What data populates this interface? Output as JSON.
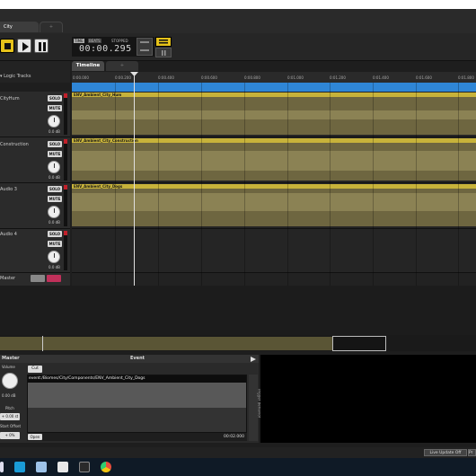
{
  "tabs": {
    "active": "City",
    "new_tab": "+"
  },
  "transport": {
    "chips": [
      "TIME",
      "BEATS",
      "STOPPED"
    ],
    "time": "00:00.295"
  },
  "tracks_header": {
    "label": "Logic Tracks"
  },
  "timeline": {
    "tab_label": "Timeline",
    "tab2_label": "+",
    "ticks": [
      "0:00.000",
      "0:00.200",
      "0:00.400",
      "0:00.600",
      "0:00.800",
      "0:01.000",
      "0:01.200",
      "0:01.400",
      "0:01.600",
      "0:01.800"
    ]
  },
  "tracks": [
    {
      "name": "CityHum",
      "solo": "SOLO",
      "mute": "MUTE",
      "db": "0.0 dB",
      "region": "ENV_Ambient_City_Hum"
    },
    {
      "name": "Construction",
      "solo": "SOLO",
      "mute": "MUTE",
      "db": "0.0 dB",
      "region": "ENV_Ambient_City_Construction"
    },
    {
      "name": "Audio 3",
      "solo": "SOLO",
      "mute": "MUTE",
      "db": "0.0 dB",
      "region": "ENV_Ambient_City_Dogs"
    },
    {
      "name": "Audio 4",
      "solo": "SOLO",
      "mute": "MUTE",
      "db": "0.0 dB",
      "region": ""
    }
  ],
  "master": {
    "name": "Master"
  },
  "deck": {
    "left_title": "Master",
    "center_title": "Event",
    "volume_label": "Volume",
    "volume_db": "0.00 dB",
    "pitch_label": "Pitch",
    "pitch_value": "+ 0.00 st",
    "offset_label": "Start Offset",
    "offset_value": "+ 0%",
    "cut_label": "Cut",
    "path": "event:/Biomes/City/Components/ENV_Ambient_City_Dogs",
    "open_label": "Open",
    "time": "00:02.000",
    "trigger_label": "Trigger Behavior"
  },
  "status": {
    "live_update": "Live Update Off",
    "extra": "Pr"
  },
  "colors": {
    "accent_yellow": "#e6c21a",
    "region_head": "#c7b23a",
    "timeline_blue": "#2f86d6",
    "meter_red": "#c0202a"
  }
}
